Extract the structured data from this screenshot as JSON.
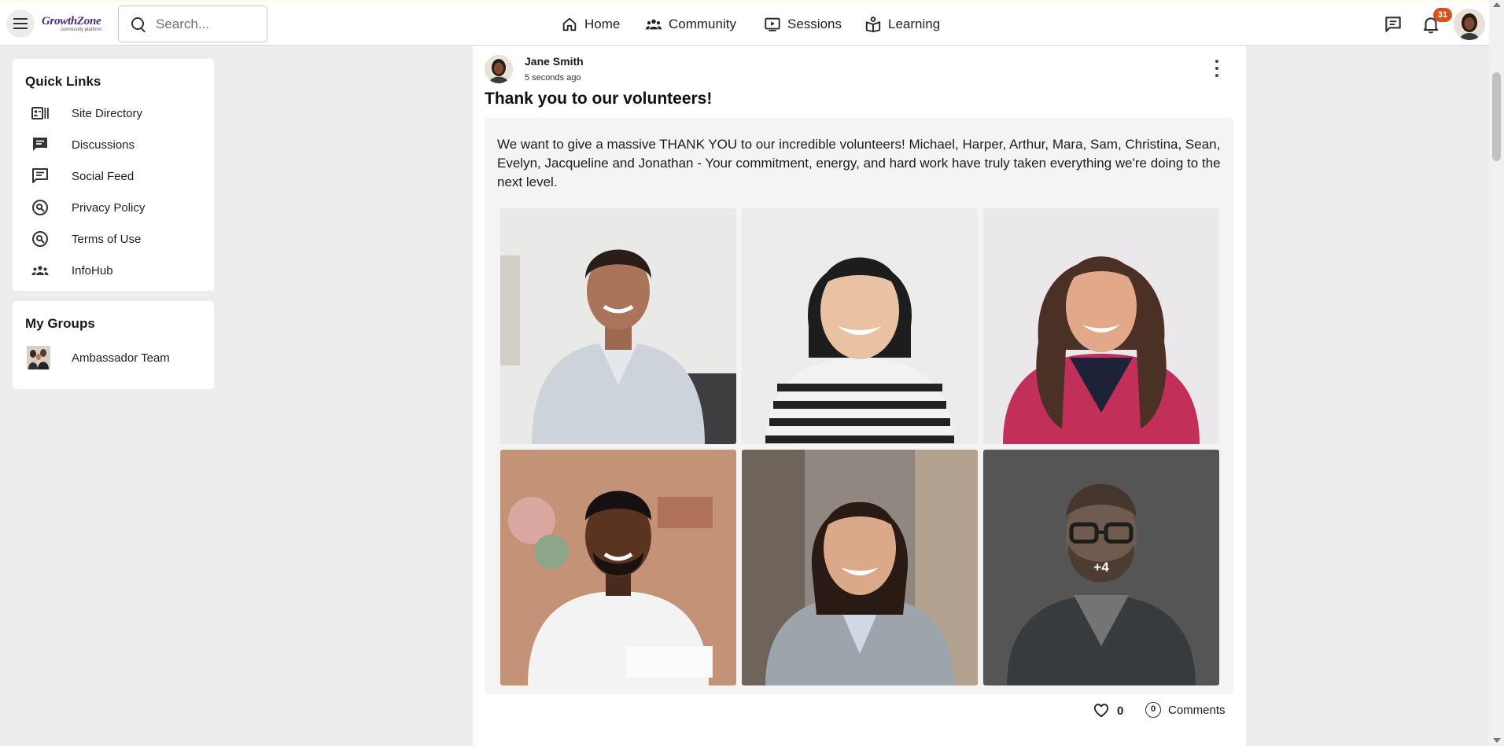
{
  "header": {
    "logo_text": "GrowthZone",
    "logo_tagline": "community platform",
    "search_placeholder": "Search...",
    "nav": [
      {
        "label": "Home",
        "icon": "home-icon"
      },
      {
        "label": "Community",
        "icon": "people-icon"
      },
      {
        "label": "Sessions",
        "icon": "video-icon"
      },
      {
        "label": "Learning",
        "icon": "learning-icon"
      }
    ],
    "notification_count": "31",
    "accent_color": "#d8501c"
  },
  "sidebar": {
    "quick_links": {
      "title": "Quick Links",
      "items": [
        {
          "label": "Site Directory",
          "icon": "directory-icon"
        },
        {
          "label": "Discussions",
          "icon": "chat-icon"
        },
        {
          "label": "Social Feed",
          "icon": "chat-icon"
        },
        {
          "label": "Privacy Policy",
          "icon": "link-icon"
        },
        {
          "label": "Terms of Use",
          "icon": "link-icon"
        },
        {
          "label": "InfoHub",
          "icon": "group-icon"
        }
      ]
    },
    "my_groups": {
      "title": "My Groups",
      "items": [
        {
          "label": "Ambassador Team",
          "icon": "group-avatar"
        }
      ]
    }
  },
  "post": {
    "author": "Jane Smith",
    "time": "5 seconds ago",
    "title": "Thank you to our volunteers!",
    "body": "We want to give a massive THANK YOU to our incredible volunteers! Michael, Harper, Arthur, Mara, Sam, Christina, Sean, Evelyn, Jacqueline and Jonathan - Your commitment, energy, and hard work have truly taken everything we're doing to the next level.",
    "more_photos": "+4",
    "likes": "0",
    "comments_count": "0",
    "comments_label": "Comments"
  }
}
